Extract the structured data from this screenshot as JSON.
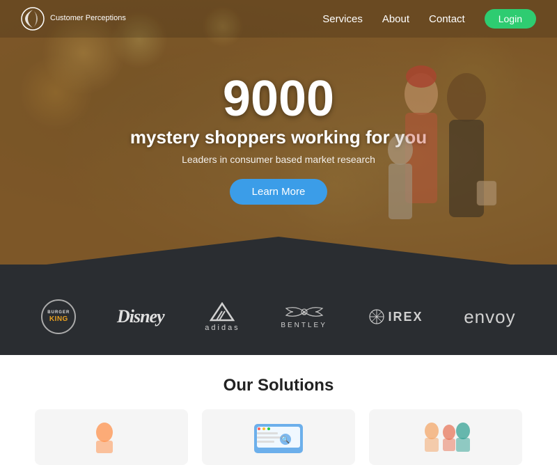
{
  "header": {
    "logo_text": "Customer Perceptions",
    "nav": {
      "services_label": "Services",
      "about_label": "About",
      "contact_label": "Contact",
      "login_label": "Login"
    }
  },
  "hero": {
    "number": "9000",
    "tagline": "mystery shoppers working for you",
    "subtitle": "Leaders in consumer based market research",
    "cta_label": "Learn More"
  },
  "brands": {
    "items": [
      {
        "name": "Burger King",
        "type": "bk"
      },
      {
        "name": "Disney",
        "type": "disney"
      },
      {
        "name": "adidas",
        "type": "adidas"
      },
      {
        "name": "BENTLEY",
        "type": "bentley"
      },
      {
        "name": "IREX",
        "type": "irex"
      },
      {
        "name": "envoy",
        "type": "envoy"
      }
    ]
  },
  "solutions": {
    "title": "Our Solutions"
  }
}
